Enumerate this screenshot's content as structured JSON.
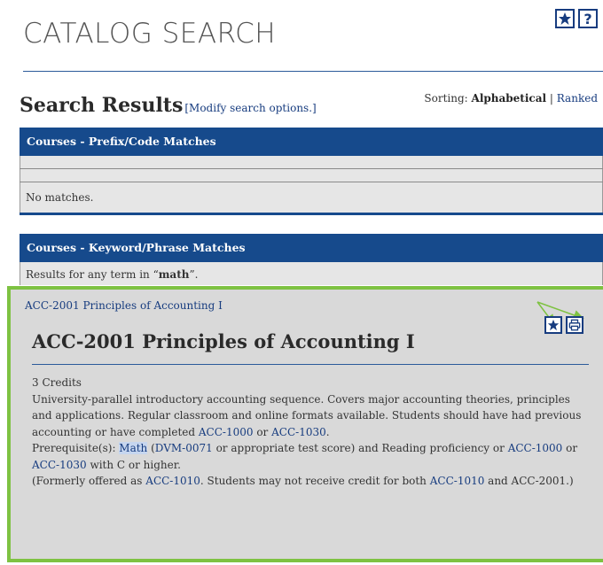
{
  "header": {
    "title": "CATALOG SEARCH",
    "favorites_icon": "star-icon",
    "help_icon": "help-icon",
    "help_glyph": "?"
  },
  "results": {
    "heading": "Search Results",
    "modify_link": "[Modify search options.]",
    "sorting_label": "Sorting:",
    "sorting_selected": "Alphabetical",
    "sorting_separator": "|",
    "sorting_other": "Ranked"
  },
  "prefix_panel": {
    "header": "Courses - Prefix/Code Matches",
    "empty_message": "No matches."
  },
  "keyword_panel": {
    "header": "Courses - Keyword/Phrase Matches",
    "results_prefix": "Results for any term in “",
    "search_term": "math",
    "results_suffix": "”."
  },
  "course": {
    "link_text": "ACC-2001 Principles of Accounting I",
    "title": "ACC-2001 Principles of Accounting I",
    "credits": "3 Credits",
    "description_1": "University-parallel introductory accounting sequence. Covers major accounting theories, principles and applications. Regular classroom and online formats available. Students should have had previous accounting or have completed ",
    "link_acc1000": "ACC-1000",
    "or_1": " or ",
    "link_acc1030": "ACC-1030",
    "period_1": ".",
    "prereq_label": "Prerequisite(s): ",
    "prereq_math": "Math",
    "prereq_open": " (",
    "prereq_dvm": "DVM-0071",
    "prereq_rest": " or appropriate test score) and Reading proficiency or ",
    "prereq_acc1000": "ACC-1000",
    "or_2": " or ",
    "prereq_acc1030": "ACC-1030",
    "prereq_end": " with C or higher.",
    "formerly_1": "(Formerly offered as ",
    "formerly_acc1010": "ACC-1010",
    "formerly_2": ". Students may not receive credit for both ",
    "formerly_acc1010b": "ACC-1010",
    "formerly_3": " and ACC-2001.)",
    "favorite_icon": "star-icon",
    "print_icon": "print-icon"
  },
  "colors": {
    "header_blue": "#164a8c",
    "link_blue": "#173c7f",
    "highlight_green": "#7ec242",
    "panel_gray": "#d9d9d9"
  }
}
